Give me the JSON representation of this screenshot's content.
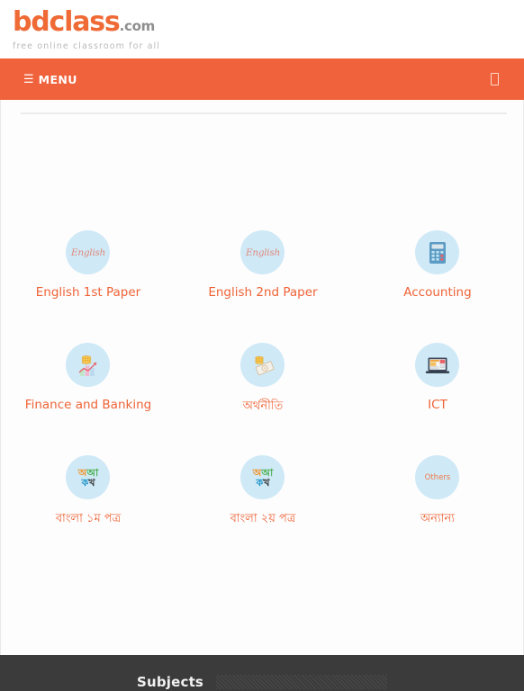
{
  "site": {
    "logo_main": "bdclass",
    "logo_suffix": ".com",
    "tagline": "free online classroom for all"
  },
  "navbar": {
    "hamburger_icon": "hamburger-icon",
    "menu_label": "MENU",
    "right_icon": "missing-glyph-box-icon"
  },
  "subjects": [
    {
      "label": "English 1st Paper",
      "icon": "english-script-icon",
      "icon_text": "English",
      "script": "latin"
    },
    {
      "label": "English 2nd Paper",
      "icon": "english-script-icon",
      "icon_text": "English",
      "script": "latin"
    },
    {
      "label": "Accounting",
      "icon": "calculator-icon",
      "icon_text": "",
      "script": "latin"
    },
    {
      "label": "Finance and Banking",
      "icon": "bar-chart-coins-icon",
      "icon_text": "",
      "script": "latin"
    },
    {
      "label": "অর্থনীতি",
      "icon": "money-banknote-coins-icon",
      "icon_text": "",
      "script": "bengali"
    },
    {
      "label": "ICT",
      "icon": "laptop-icon",
      "icon_text": "",
      "script": "latin"
    },
    {
      "label": "বাংলা ১ম পত্র",
      "icon": "bengali-letters-icon",
      "icon_text": "অ আ ক খ",
      "script": "bengali"
    },
    {
      "label": "বাংলা ২য় পত্র",
      "icon": "bengali-letters-icon",
      "icon_text": "অ আ ক খ",
      "script": "bengali"
    },
    {
      "label": "অন্যান্য",
      "icon": "others-text-icon",
      "icon_text": "Others",
      "script": "bengali"
    }
  ],
  "footer": {
    "title": "Subjects"
  },
  "colors": {
    "brand_orange": "#ef6a35",
    "nav_orange": "#f0623b",
    "icon_circle_blue": "#cfe9f7",
    "footer_dark": "#3b3b3b",
    "label_orange": "#ef6337"
  }
}
